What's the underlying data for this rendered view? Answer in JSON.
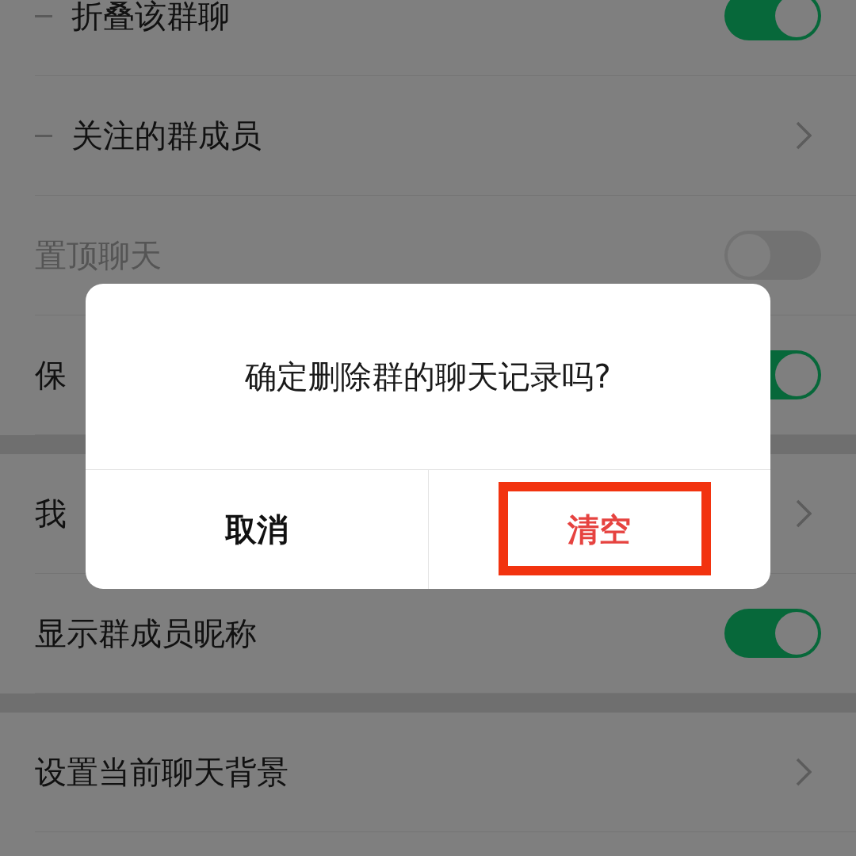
{
  "settings": {
    "sections": [
      [
        {
          "kind": "toggle",
          "label": "折叠该群聊",
          "sub_item": true,
          "on": true,
          "disabled": false
        },
        {
          "kind": "link",
          "label": "关注的群成员",
          "sub_item": true
        },
        {
          "kind": "toggle",
          "label": "置顶聊天",
          "sub_item": false,
          "on": false,
          "disabled": true
        },
        {
          "kind": "toggle",
          "label": "保",
          "sub_item": false,
          "on": true,
          "disabled": false
        }
      ],
      [
        {
          "kind": "link",
          "label": "我",
          "sub_item": false
        },
        {
          "kind": "toggle",
          "label": "显示群成员昵称",
          "sub_item": false,
          "on": true,
          "disabled": false
        }
      ],
      [
        {
          "kind": "link",
          "label": "设置当前聊天背景",
          "sub_item": false
        }
      ]
    ]
  },
  "dialog": {
    "message": "确定删除群的聊天记录吗?",
    "buttons": [
      {
        "kind": "cancel",
        "label": "取消",
        "highlighted": false
      },
      {
        "kind": "destructive",
        "label": "清空",
        "highlighted": true
      }
    ]
  }
}
